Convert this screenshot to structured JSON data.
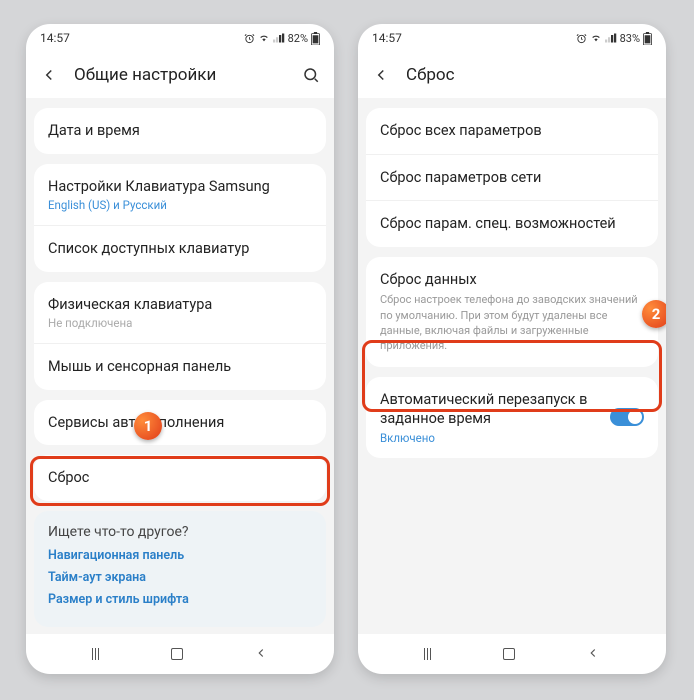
{
  "left": {
    "status": {
      "time": "14:57",
      "battery": "82%"
    },
    "header": {
      "title": "Общие настройки"
    },
    "g1": {
      "r0": "Дата и время"
    },
    "g2": {
      "r0": {
        "title": "Настройки Клавиатура Samsung",
        "sub": "English (US) и Русский"
      },
      "r1": "Список доступных клавиатур"
    },
    "g3": {
      "r0": {
        "title": "Физическая клавиатура",
        "sub": "Не подключена"
      },
      "r1": "Мышь и сенсорная панель"
    },
    "g4": {
      "r0": "Сервисы автозаполнения"
    },
    "g5": {
      "r0": "Сброс"
    },
    "footer": {
      "title": "Ищете что-то другое?",
      "l0": "Навигационная панель",
      "l1": "Тайм-аут экрана",
      "l2": "Размер и стиль шрифта"
    },
    "badge": "1"
  },
  "right": {
    "status": {
      "time": "14:57",
      "battery": "83%"
    },
    "header": {
      "title": "Сброс"
    },
    "g1": {
      "r0": "Сброс всех параметров",
      "r1": "Сброс параметров сети",
      "r2": "Сброс парам. спец. возможностей"
    },
    "g2": {
      "r0": {
        "title": "Сброс данных",
        "desc": "Сброс настроек телефона до заводских значений по умолчанию. При этом будут удалены все данные, включая файлы и загруженные приложения."
      }
    },
    "g3": {
      "r0": {
        "title": "Автоматический перезапуск в заданное время",
        "sub": "Включено"
      }
    },
    "badge": "2"
  }
}
